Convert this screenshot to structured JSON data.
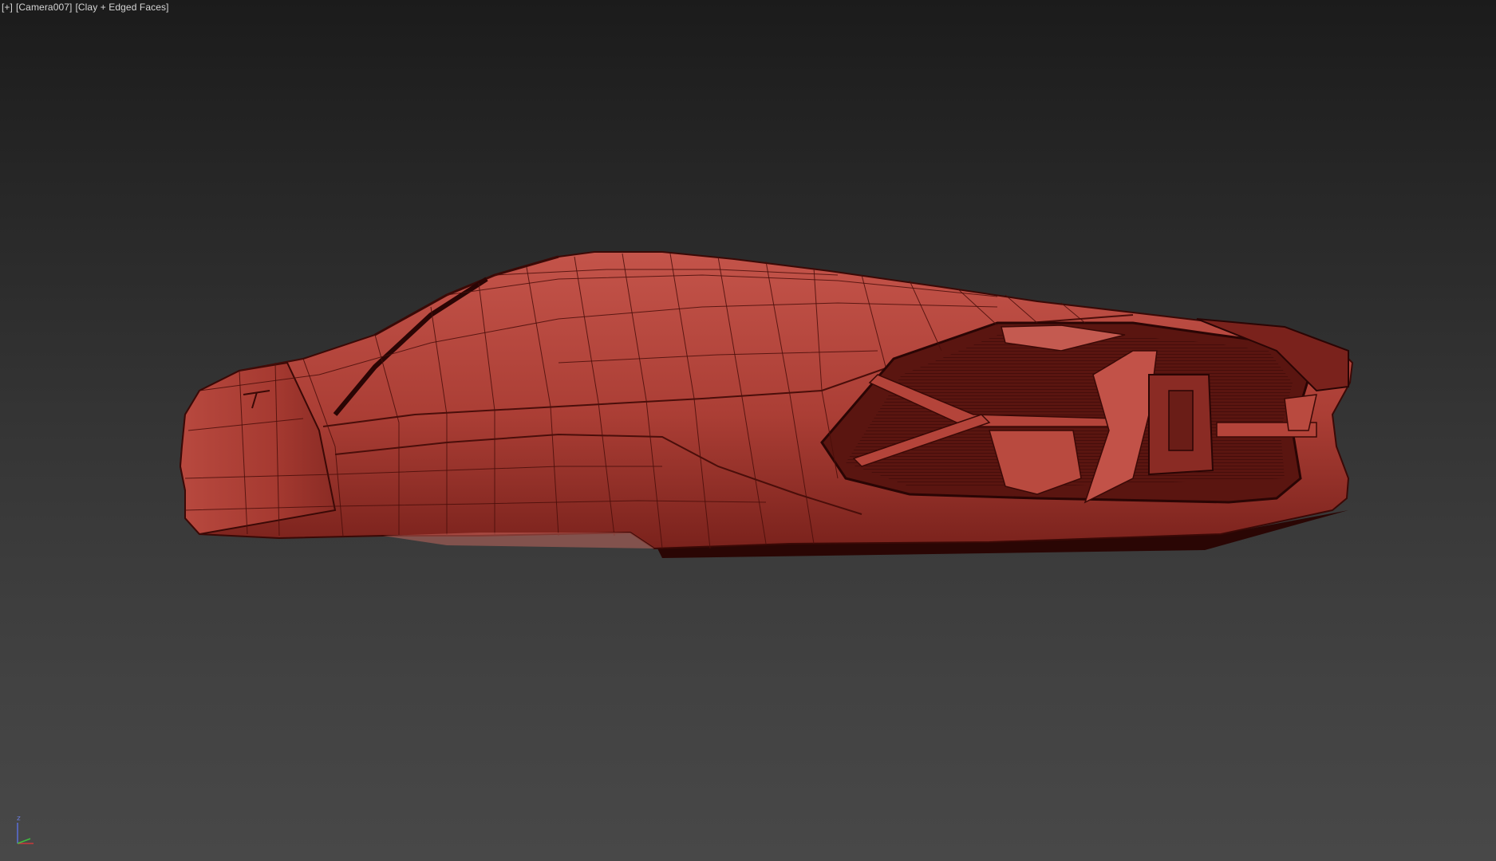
{
  "viewport": {
    "label_plus": "[+]",
    "label_camera": "[Camera007]",
    "label_shading": "[Clay + Edged Faces]"
  },
  "model": {
    "name": "car-wireframe",
    "base_color": "#b4443a",
    "edge_color": "#4a0e0a",
    "shadow_color": "#2a0403"
  },
  "gizmo": {
    "z_label": "z"
  }
}
